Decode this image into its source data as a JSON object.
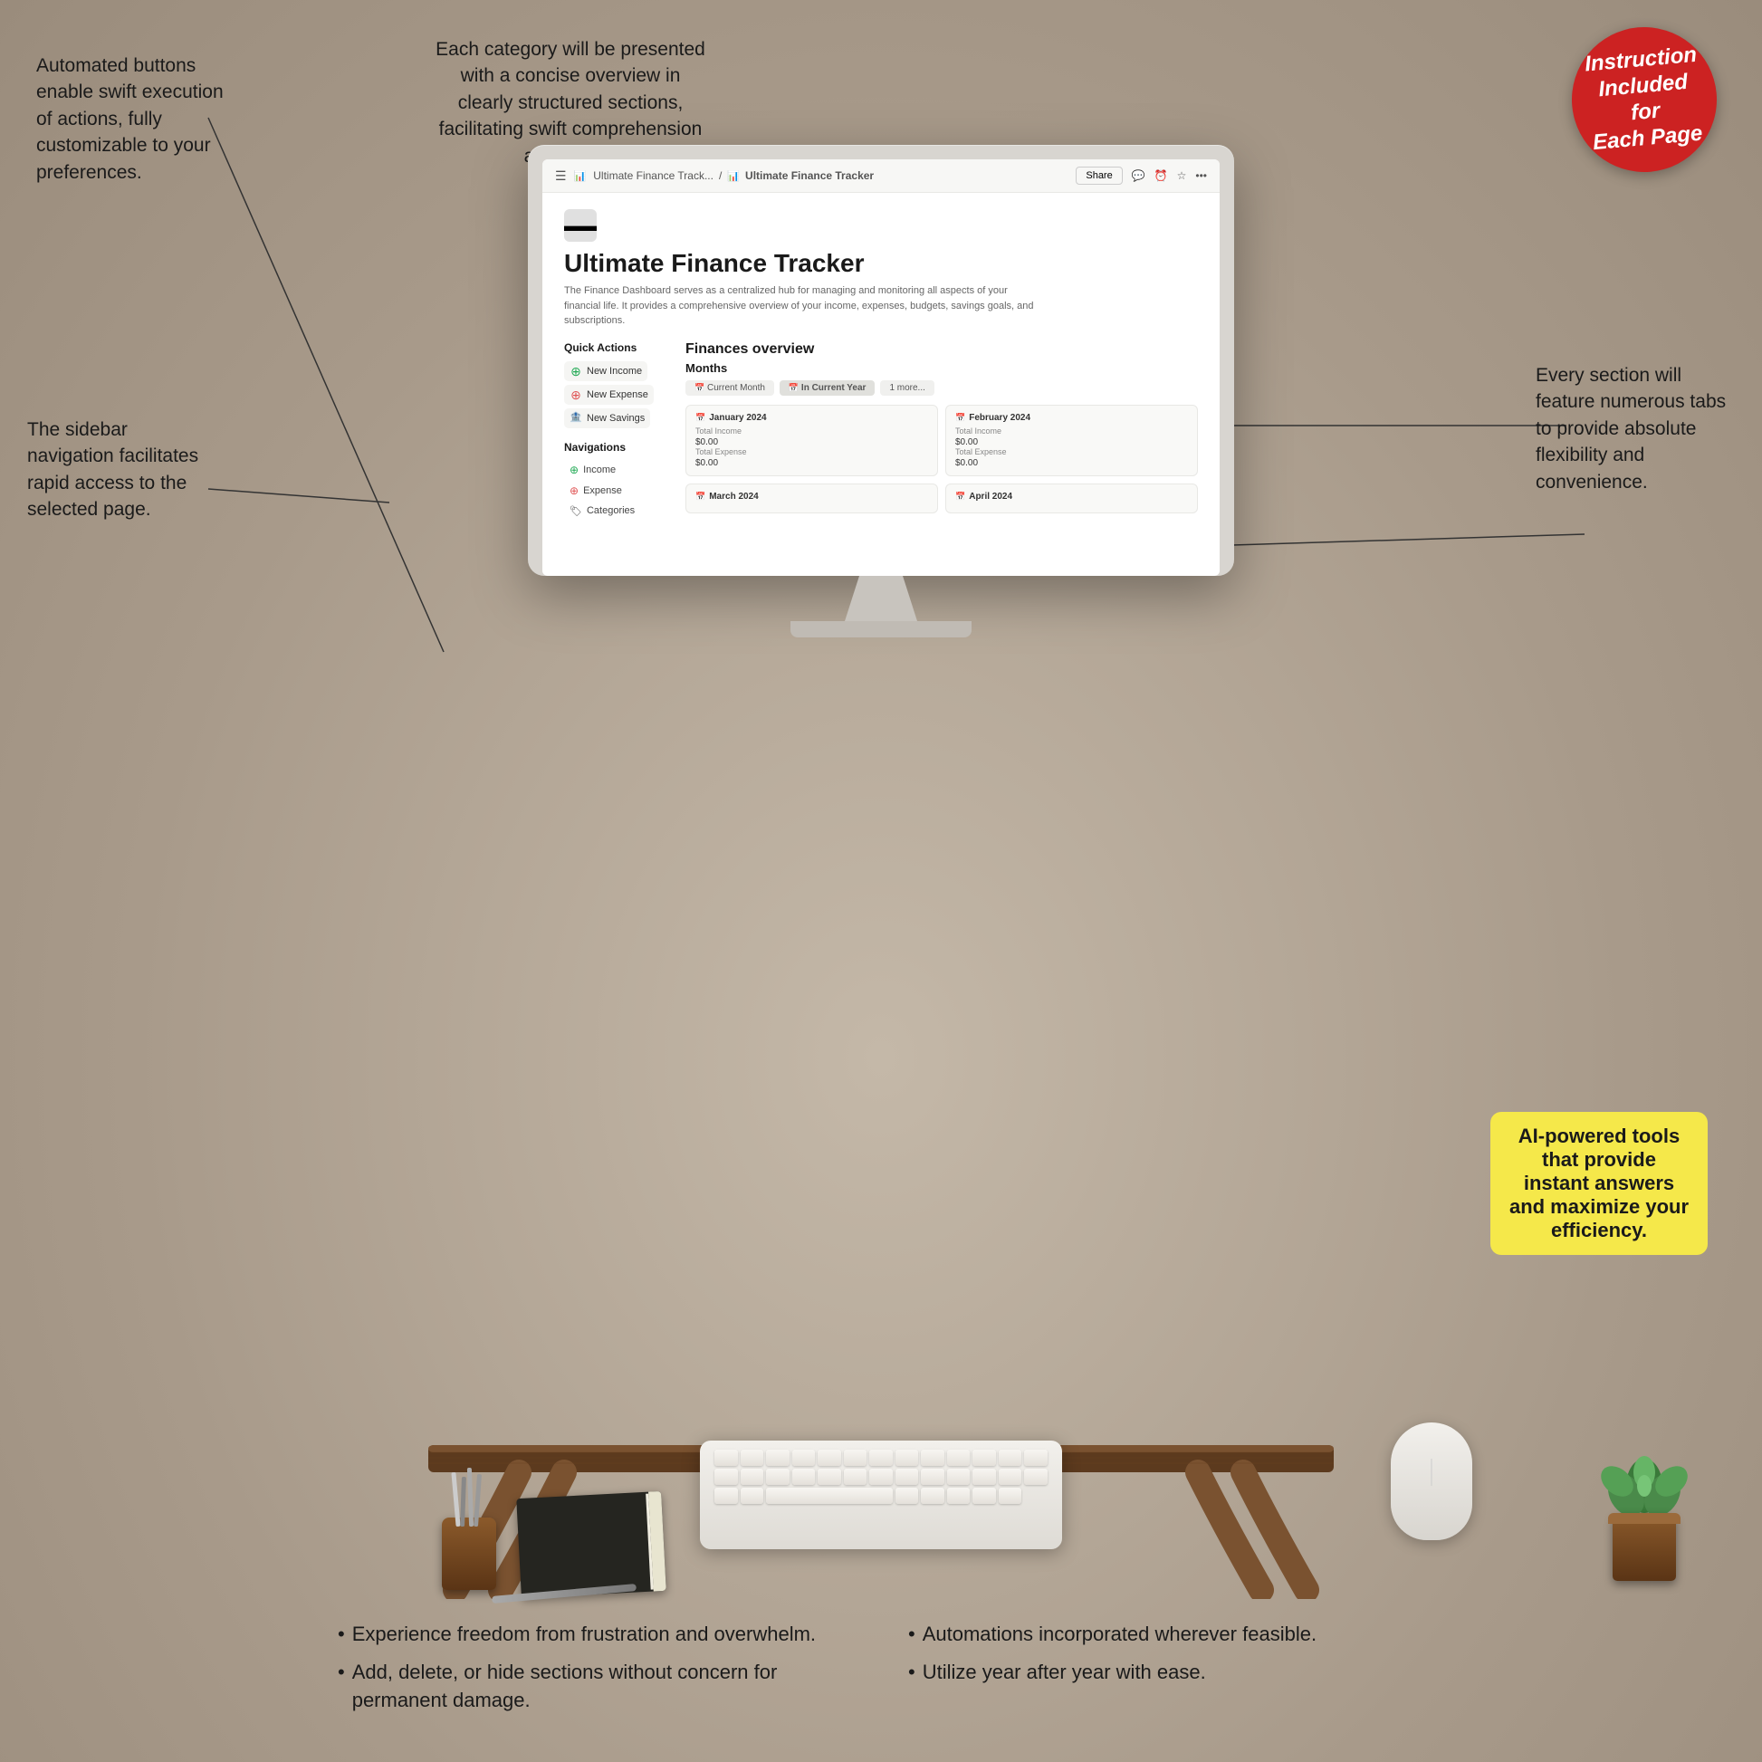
{
  "background_color": "#b5a99a",
  "annotations": {
    "top_left": {
      "text": "Automated buttons enable swift execution of actions, fully customizable to your preferences.",
      "position": "top-left"
    },
    "top_center": {
      "text": "Each category will be presented with a concise overview in clearly structured sections, facilitating swift comprehension and action.",
      "position": "top-center"
    },
    "right_tabs": {
      "text": "Every section will feature numerous tabs to provide absolute flexibility and convenience.",
      "position": "right"
    },
    "left_sidebar": {
      "text": "The sidebar navigation facilitates rapid access to the selected page.",
      "position": "left"
    },
    "ai_badge": {
      "text": "AI-powered tools that provide instant answers and maximize your efficiency.",
      "position": "bottom-right"
    }
  },
  "instruction_badge": {
    "line1": "Instruction",
    "line2": "Included",
    "line3": "for",
    "line4": "Each Page"
  },
  "monitor": {
    "breadcrumb": {
      "item1": "Ultimate Finance Track...",
      "separator": "/",
      "item2": "Ultimate Finance Tracker"
    },
    "top_right_actions": [
      "Share",
      "💬",
      "⏰",
      "☆",
      "•••"
    ],
    "page_icon": "▬▬",
    "page_title": "Ultimate Finance Tracker",
    "page_desc": "The Finance Dashboard serves as a centralized hub for managing and monitoring all aspects of your financial life. It provides a comprehensive overview of your income, expenses, budgets, savings goals, and subscriptions.",
    "quick_actions": {
      "title": "Quick Actions",
      "buttons": [
        {
          "icon": "+",
          "label": "New Income",
          "color": "#22aa55"
        },
        {
          "icon": "+",
          "label": "New Expense",
          "color": "#e05555"
        },
        {
          "icon": "🏦",
          "label": "New Savings",
          "color": "#555"
        }
      ]
    },
    "navigations": {
      "title": "Navigations",
      "items": [
        {
          "icon": "+",
          "label": "Income"
        },
        {
          "icon": "+",
          "label": "Expense"
        },
        {
          "icon": "🏷",
          "label": "Categories"
        }
      ]
    },
    "finances_overview": {
      "title": "Finances overview",
      "months_title": "Months",
      "tabs": [
        {
          "label": "Current Month",
          "active": false
        },
        {
          "label": "In Current Year",
          "active": true
        },
        {
          "label": "1 more...",
          "active": false
        }
      ],
      "months": [
        {
          "name": "January 2024",
          "total_income_label": "Total Income",
          "total_income": "$0.00",
          "total_expense_label": "Total Expense",
          "total_expense": "$0.00"
        },
        {
          "name": "February 2024",
          "total_income_label": "Total Income",
          "total_income": "$0.00",
          "total_expense_label": "Total Expense",
          "total_expense": "$0.00"
        },
        {
          "name": "March 2024",
          "total_income_label": "",
          "total_income": "",
          "total_expense_label": "",
          "total_expense": ""
        },
        {
          "name": "April 2024",
          "total_income_label": "",
          "total_income": "",
          "total_expense_label": "",
          "total_expense": ""
        }
      ]
    }
  },
  "bullet_points": {
    "left": [
      "Experience freedom from frustration and overwhelm.",
      "Add, delete, or hide sections without concern for permanent damage."
    ],
    "right": [
      "Automations incorporated wherever feasible.",
      "Utilize year after year with ease."
    ]
  }
}
